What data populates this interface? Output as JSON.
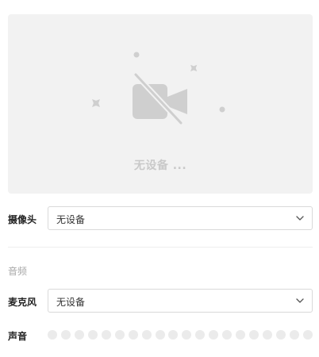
{
  "preview": {
    "status_text": "无设备 ...",
    "icon": "camera-off-icon"
  },
  "camera": {
    "label": "摄像头",
    "selected": "无设备"
  },
  "audio": {
    "section_title": "音频",
    "microphone": {
      "label": "麦克风",
      "selected": "无设备"
    },
    "volume": {
      "label": "声音",
      "level": 0,
      "dot_count": 20
    }
  },
  "colors": {
    "preview_bg": "#f2f2f2",
    "placeholder_gray": "#cfcfcf",
    "dot_inactive": "#ebebeb",
    "border": "#d9d9d9"
  }
}
